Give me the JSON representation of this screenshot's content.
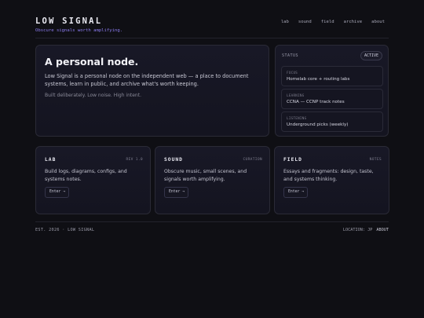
{
  "header": {
    "brand": "LOW SIGNAL",
    "tagline": "Obscure signals worth amplifying.",
    "nav": [
      "lab",
      "sound",
      "field",
      "archive",
      "about"
    ]
  },
  "hero": {
    "title": "A personal node.",
    "lead": "Low Signal is a personal node on the independent web — a place to document systems, learn in public, and archive what's worth keeping.",
    "sub": "Built deliberately. Low noise. High intent."
  },
  "status": {
    "label": "STATUS",
    "badge": "ACTIVE",
    "items": [
      {
        "key": "FOCUS",
        "value": "Homelab core + routing labs"
      },
      {
        "key": "LEARNING",
        "value": "CCNA — CCNP track notes"
      },
      {
        "key": "LISTENING",
        "value": "Underground picks (weekly)"
      }
    ]
  },
  "tiles": [
    {
      "title": "LAB",
      "tag": "REV 1.0",
      "desc": "Build logs, diagrams, configs, and systems notes.",
      "button": "Enter →"
    },
    {
      "title": "SOUND",
      "tag": "CURATION",
      "desc": "Obscure music, small scenes, and signals worth amplifying.",
      "button": "Enter →"
    },
    {
      "title": "FIELD",
      "tag": "NOTES",
      "desc": "Essays and fragments: design, taste, and systems thinking.",
      "button": "Enter →"
    }
  ],
  "footer": {
    "left": "EST. 2026 · LOW SIGNAL",
    "location": "LOCATION: JP",
    "about": "ABOUT"
  },
  "colors": {
    "background": "#0f0f14",
    "accent": "#8c7cf0",
    "card": "#181826",
    "border": "#2a2a36"
  }
}
